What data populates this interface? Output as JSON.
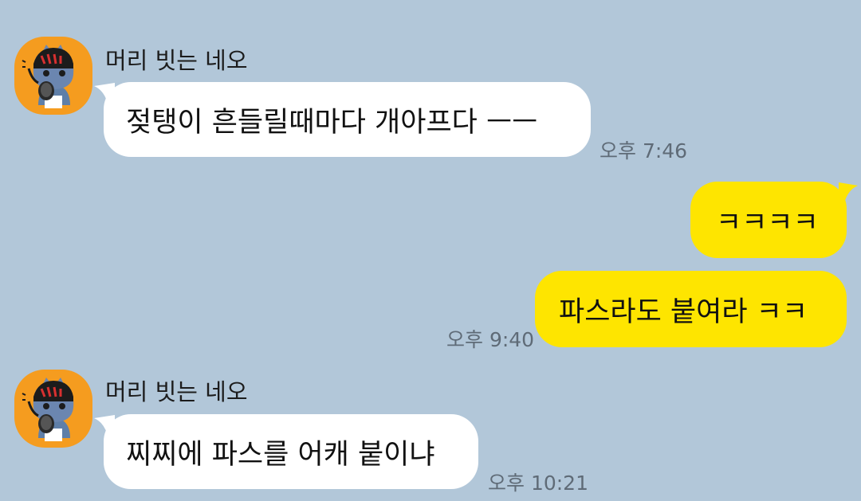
{
  "colors": {
    "background": "#b2c7d9",
    "incoming_bubble": "#ffffff",
    "outgoing_bubble": "#fee500",
    "avatar_background": "#f59c1f",
    "time_text": "#5f6b77"
  },
  "messages": [
    {
      "direction": "incoming",
      "sender": "머리 빗는 네오",
      "avatar_icon": "neo-character-avatar-icon",
      "text": "젖탱이 흔들릴때마다 개아프다 ㅡㅡ",
      "time": "오후 7:46"
    },
    {
      "direction": "outgoing",
      "text": "ㅋㅋㅋㅋ"
    },
    {
      "direction": "outgoing",
      "text": "파스라도 붙여라 ㅋㅋ",
      "time": "오후 9:40"
    },
    {
      "direction": "incoming",
      "sender": "머리 빗는 네오",
      "avatar_icon": "neo-character-avatar-icon",
      "text": "찌찌에 파스를 어캐 붙이냐",
      "time": "오후 10:21"
    }
  ]
}
